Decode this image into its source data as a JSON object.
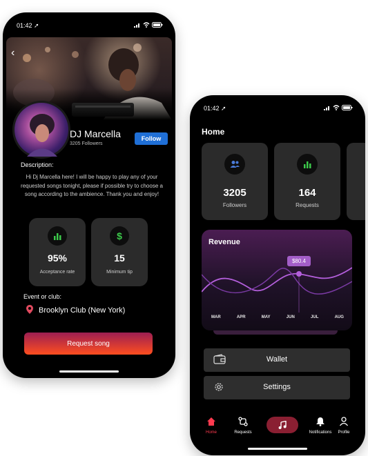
{
  "left_phone": {
    "status": {
      "time": "01:42 ➚"
    },
    "dj": {
      "name": "DJ Marcella",
      "followers": "3205 Followers"
    },
    "follow_label": "Follow",
    "description_title": "Description:",
    "description": "Hi Dj Marcella here! I will be happy to play any of your requested songs tonight, please if possible try to choose a song according to the ambience. Thank you and enjoy!",
    "stats": [
      {
        "value": "95%",
        "label": "Acceptance rate",
        "icon": "bar-chart-icon"
      },
      {
        "value": "15",
        "label": "Minimum tip",
        "icon": "dollar-icon"
      }
    ],
    "event_label": "Event or club:",
    "event_name": "Brooklyn Club (New York)",
    "request_label": "Request song"
  },
  "right_phone": {
    "status": {
      "time": "01:42 ➚"
    },
    "title": "Home",
    "cards": [
      {
        "value": "3205",
        "label": "Followers",
        "icon": "users-icon"
      },
      {
        "value": "164",
        "label": "Requests",
        "icon": "bar-chart-icon"
      }
    ],
    "revenue": {
      "title": "Revenue",
      "tooltip": "$80.4",
      "months": [
        "MAR",
        "APR",
        "MAY",
        "JUN",
        "JUL",
        "AUG"
      ]
    },
    "menu": [
      {
        "label": "Wallet",
        "icon": "wallet-icon"
      },
      {
        "label": "Settings",
        "icon": "gear-icon"
      }
    ],
    "nav": [
      {
        "label": "Home",
        "icon": "home-icon",
        "active": true
      },
      {
        "label": "Requests",
        "icon": "requests-icon"
      },
      {
        "label": "",
        "icon": "music-note-icon"
      },
      {
        "label": "Notifications",
        "icon": "bell-icon"
      },
      {
        "label": "Profile",
        "icon": "user-icon"
      }
    ]
  },
  "colors": {
    "accent_blue": "#1f6fd6",
    "stat_green": "#3cc94a",
    "active_red": "#ff3a4f",
    "gradient_start": "#9c1e52",
    "gradient_end": "#ff4e1f",
    "chart_purple": "#a35ec8"
  }
}
